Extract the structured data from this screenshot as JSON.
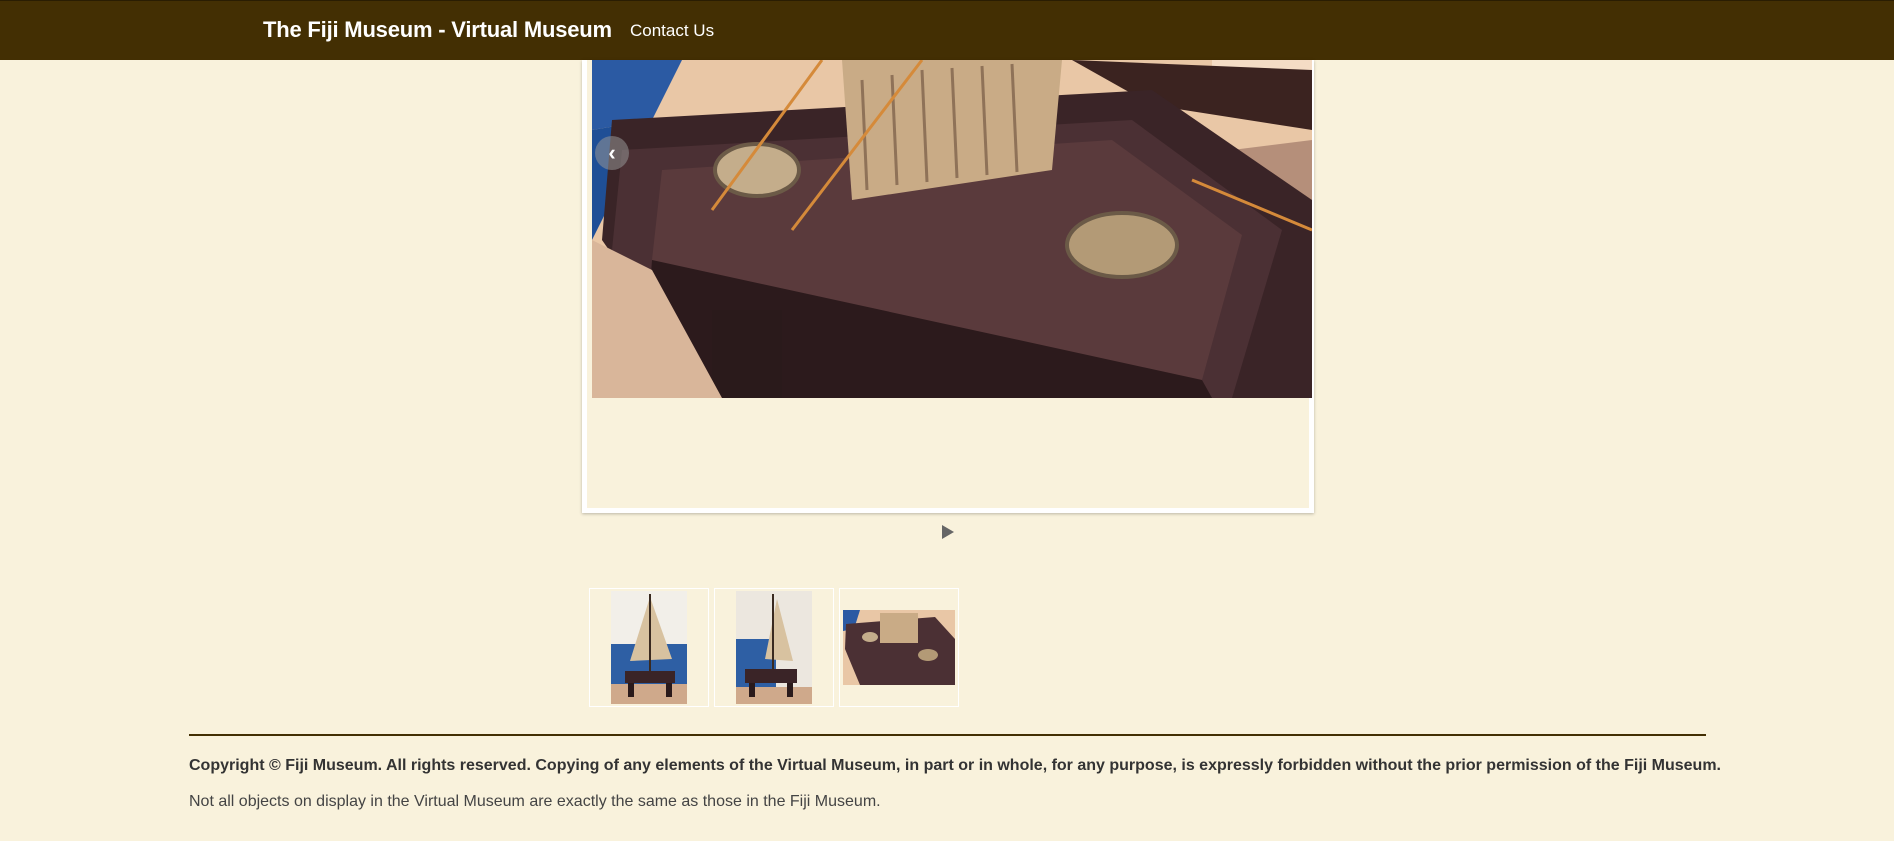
{
  "header": {
    "brand": "The Fiji Museum - Virtual Museum",
    "nav": [
      {
        "label": "Contact Us"
      }
    ]
  },
  "viewer": {
    "prev_icon": "chevron-left-icon",
    "play_icon": "play-icon",
    "main_image": "canoe deck model close-up"
  },
  "thumbnails": [
    {
      "subject": "canoe model with sail, front view"
    },
    {
      "subject": "canoe model with sail, angled view"
    },
    {
      "subject": "canoe deck model close-up"
    }
  ],
  "footer": {
    "copyright": "Copyright © Fiji Museum. All rights reserved. Copying of any elements of the Virtual Museum, in part or in whole, for any purpose, is expressly forbidden without the prior permission of the Fiji Museum.",
    "disclaimer": "Not all objects on display in the Virtual Museum are exactly the same as those in the Fiji Museum."
  },
  "colors": {
    "header_bg": "#432f03",
    "page_bg": "#f9f2dc"
  }
}
